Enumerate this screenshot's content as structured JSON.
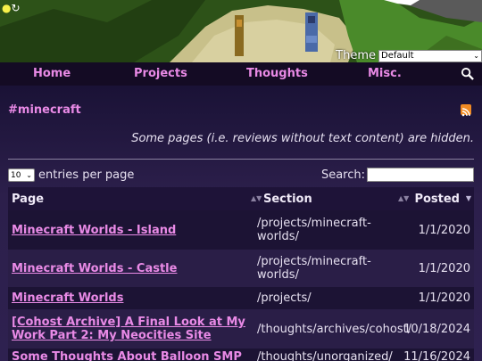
{
  "banner": {
    "theme_label": "Theme",
    "theme_value": "Default"
  },
  "nav": {
    "home": "Home",
    "projects": "Projects",
    "thoughts": "Thoughts",
    "misc": "Misc."
  },
  "tag": {
    "title": "#minecraft",
    "note": "Some pages (i.e. reviews without text content) are hidden."
  },
  "controls": {
    "entries_value": "10",
    "entries_label": "entries per page",
    "search_label": "Search:"
  },
  "table": {
    "headers": {
      "page": "Page",
      "section": "Section",
      "posted": "Posted"
    },
    "rows": [
      {
        "page": "Minecraft Worlds - Island",
        "section": "/projects/minecraft-worlds/",
        "posted": "1/1/2020"
      },
      {
        "page": "Minecraft Worlds - Castle",
        "section": "/projects/minecraft-worlds/",
        "posted": "1/1/2020"
      },
      {
        "page": "Minecraft Worlds",
        "section": "/projects/",
        "posted": "1/1/2020"
      },
      {
        "page": "[Cohost Archive] A Final Look at My Work Part 2: My Neocities Site",
        "section": "/thoughts/archives/cohost/",
        "posted": "10/18/2024"
      },
      {
        "page": "Some Thoughts About Balloon SMP",
        "section": "/thoughts/unorganized/",
        "posted": "11/16/2024"
      }
    ]
  }
}
